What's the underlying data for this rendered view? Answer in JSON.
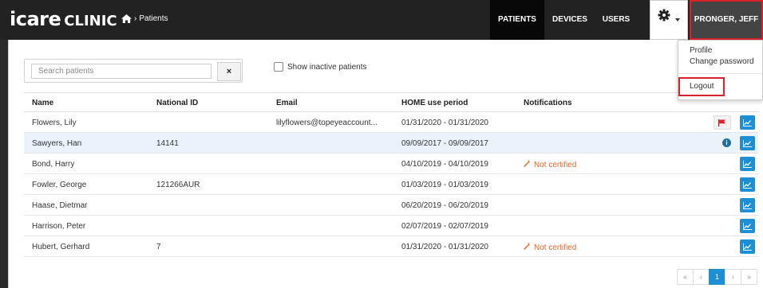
{
  "brand": {
    "icare": "icare",
    "clinic": "CLINIC"
  },
  "breadcrumb": {
    "separator": "›",
    "current": "Patients"
  },
  "nav": {
    "patients": "PATIENTS",
    "devices": "DEVICES",
    "users": "USERS",
    "user": "PRONGER, JEFF"
  },
  "search": {
    "placeholder": "Search patients",
    "value": "",
    "clear": "×"
  },
  "filters": {
    "show_inactive": "Show inactive patients"
  },
  "table": {
    "headers": {
      "name": "Name",
      "national_id": "National ID",
      "email": "Email",
      "period": "HOME use period",
      "notifications": "Notifications"
    },
    "rows": [
      {
        "name": "Flowers, Lily",
        "national_id": "",
        "email": "lilyflowers@topeyeaccount...",
        "period": "01/31/2020 - 01/31/2020",
        "notification": ""
      },
      {
        "name": "Sawyers, Han",
        "national_id": "14141",
        "email": "",
        "period": "09/09/2017 - 09/09/2017",
        "notification": ""
      },
      {
        "name": "Bond, Harry",
        "national_id": "",
        "email": "",
        "period": "04/10/2019 - 04/10/2019",
        "notification": "Not certified"
      },
      {
        "name": "Fowler, George",
        "national_id": "121266AUR",
        "email": "",
        "period": "01/03/2019 - 01/03/2019",
        "notification": ""
      },
      {
        "name": "Haase, Dietmar",
        "national_id": "",
        "email": "",
        "period": "06/20/2019 - 06/20/2019",
        "notification": ""
      },
      {
        "name": "Harrison, Peter",
        "national_id": "",
        "email": "",
        "period": "02/07/2019 - 02/07/2019",
        "notification": ""
      },
      {
        "name": "Hubert, Gerhard",
        "national_id": "7",
        "email": "",
        "period": "01/31/2020 - 01/31/2020",
        "notification": "Not certified"
      }
    ]
  },
  "pagination": {
    "first": "«",
    "prev": "‹",
    "current": "1",
    "next": "›",
    "last": "»"
  },
  "dropdown": {
    "profile": "Profile",
    "change_password": "Change password",
    "logout": "Logout"
  },
  "icons": {
    "home": "home-icon",
    "gear": "gear-icon",
    "flag": "flag-icon",
    "info": "info-icon",
    "chart": "line-chart-icon",
    "wand": "magic-wand-icon"
  },
  "colors": {
    "navbar": "#222222",
    "accent": "#1d8fd4",
    "highlight_border": "#d9222a",
    "warning": "#e8672a",
    "selected_row": "#eaf3fb"
  }
}
